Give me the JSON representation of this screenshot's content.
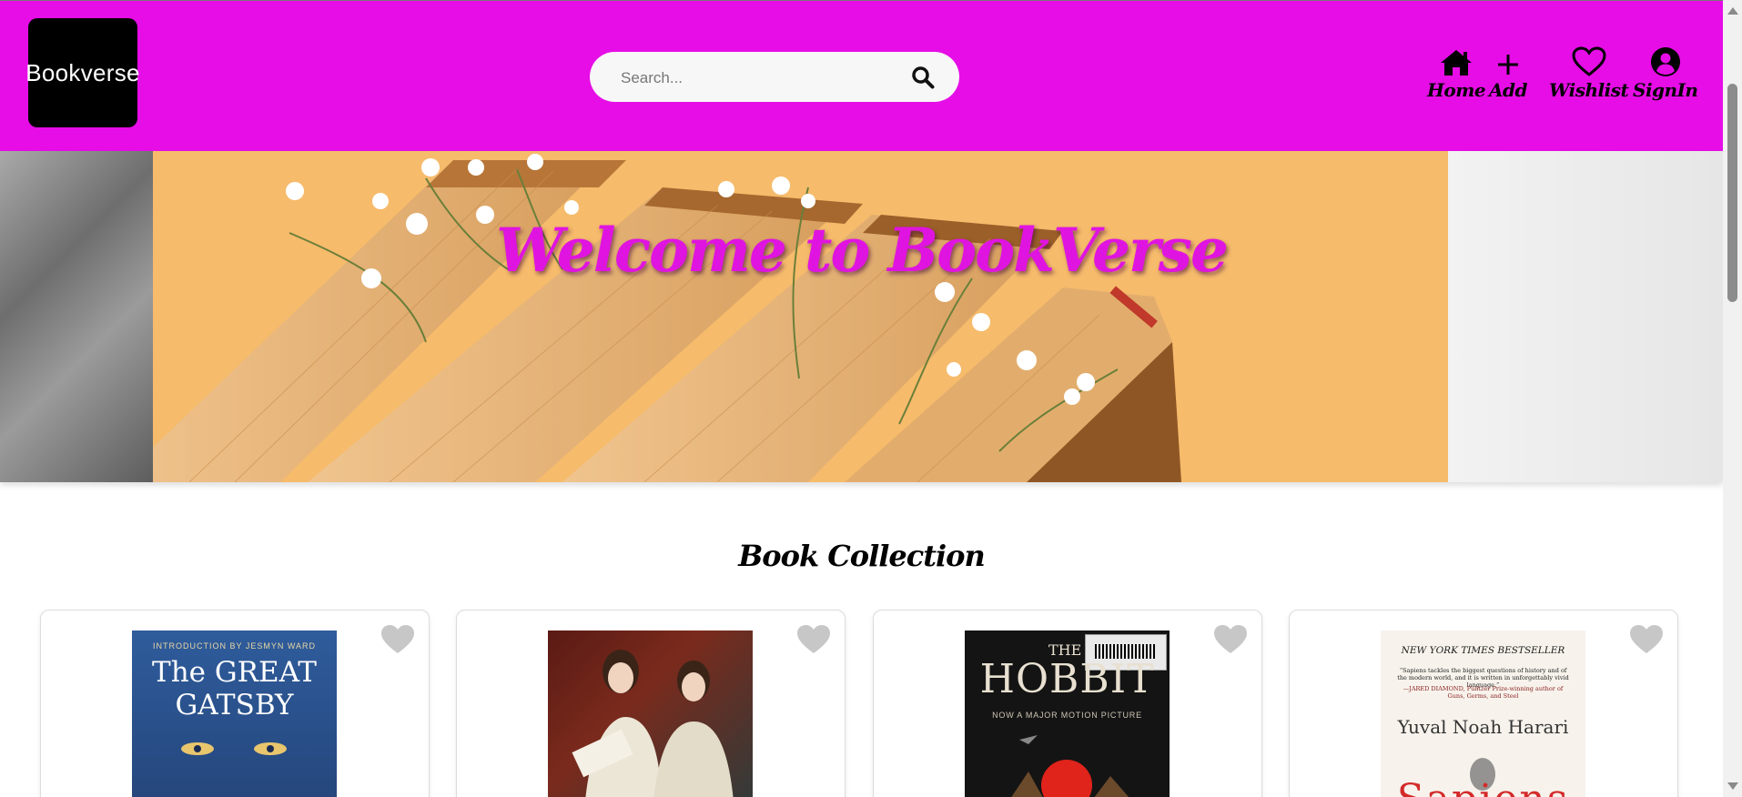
{
  "header": {
    "logo_text": "Bookverse",
    "search": {
      "placeholder": "Search...",
      "icon": "search-icon"
    },
    "nav": [
      {
        "label": "Home",
        "icon": "home-icon"
      },
      {
        "label": "Add",
        "icon": "plus-icon"
      },
      {
        "label": "Wishlist",
        "icon": "heart-outline-icon"
      },
      {
        "label": "SignIn",
        "icon": "user-circle-icon"
      }
    ],
    "background_color": "#e60de6"
  },
  "hero": {
    "title": "Welcome to BookVerse",
    "title_color": "#e014e0"
  },
  "collection": {
    "title": "Book Collection",
    "books": [
      {
        "cover_texts": [
          "INTRODUCTION BY JESMYN WARD",
          "The GREAT",
          "GATSBY"
        ],
        "favorite_icon": "heart-icon"
      },
      {
        "cover_texts": [],
        "favorite_icon": "heart-icon"
      },
      {
        "cover_texts": [
          "THE",
          "HOBBIT",
          "NOW A MAJOR MOTION PICTURE"
        ],
        "favorite_icon": "heart-icon"
      },
      {
        "cover_texts": [
          "NEW YORK TIMES BESTSELLER",
          "“Sapiens tackles the biggest questions of history and of the modern world, and it is written in unforgettably vivid language.”",
          "—JARED DIAMOND, Pulitzer Prize-winning author of Guns, Germs, and Steel",
          "Yuval Noah Harari",
          "Sapiens"
        ],
        "favorite_icon": "heart-icon"
      }
    ]
  }
}
